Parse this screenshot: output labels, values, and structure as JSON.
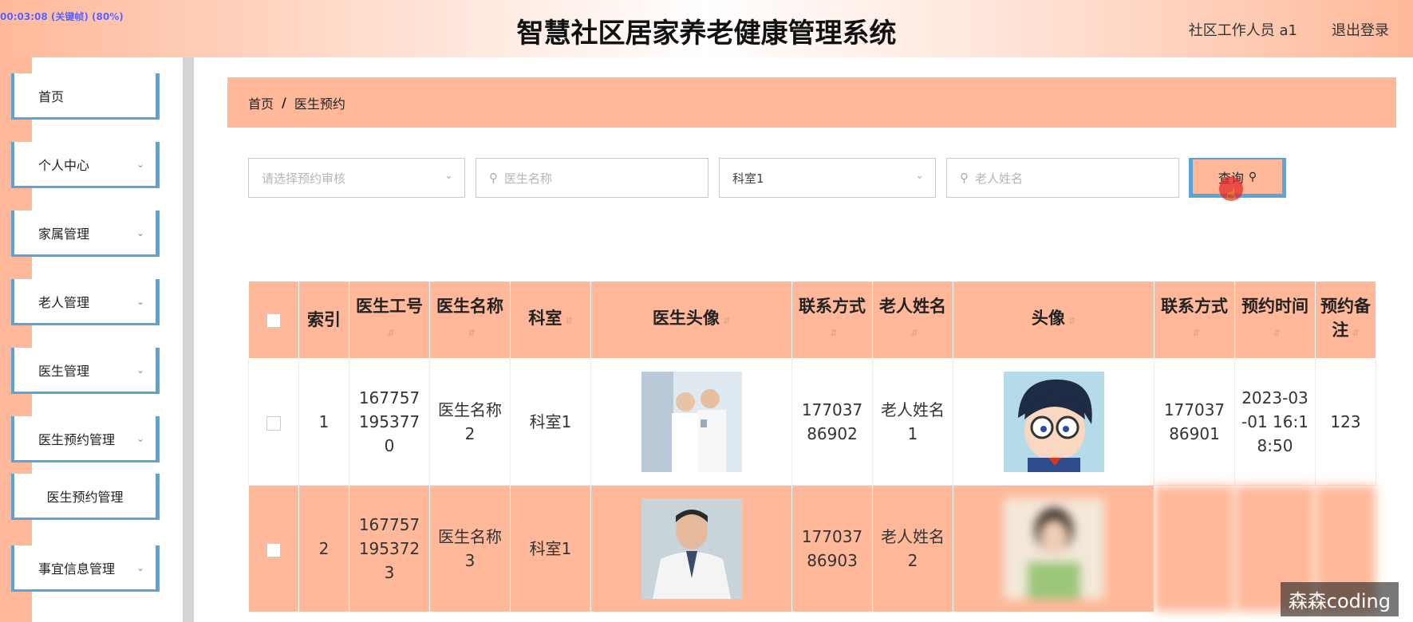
{
  "recording": "00:03:08 (关键帧) (80%)",
  "header": {
    "title": "智慧社区居家养老健康管理系统",
    "user": "社区工作人员 a1",
    "logout": "退出登录"
  },
  "sidebar": {
    "items": [
      {
        "label": "首页"
      },
      {
        "label": "个人中心"
      },
      {
        "label": "家属管理"
      },
      {
        "label": "老人管理"
      },
      {
        "label": "医生管理"
      },
      {
        "label": "医生预约管理"
      },
      {
        "label": "医生预约管理"
      },
      {
        "label": "事宜信息管理"
      }
    ]
  },
  "breadcrumb": {
    "home": "首页",
    "sep": "/",
    "current": "医生预约"
  },
  "search": {
    "audit_placeholder": "请选择预约审核",
    "doctor_placeholder": "医生名称",
    "dept_value": "科室1",
    "elder_placeholder": "老人姓名",
    "query_label": "查询"
  },
  "table": {
    "headers": [
      "索引",
      "医生工号",
      "医生名称",
      "科室",
      "医生头像",
      "联系方式",
      "老人姓名",
      "头像",
      "联系方式",
      "预约时间",
      "预约备注"
    ],
    "rows": [
      {
        "index": "1",
        "doctor_id": "1677571953770",
        "doctor_name": "医生名称2",
        "dept": "科室1",
        "doc_phone": "17703786902",
        "elder_name": "老人姓名1",
        "elder_phone": "17703786901",
        "time": "2023-03-01 16:18:50",
        "note": "123"
      },
      {
        "index": "2",
        "doctor_id": "1677571953723",
        "doctor_name": "医生名称3",
        "dept": "科室1",
        "doc_phone": "17703786903",
        "elder_name": "老人姓名2",
        "elder_phone": "",
        "time": "",
        "note": ""
      }
    ]
  },
  "watermark": "森森coding",
  "colors": {
    "accent": "#ffb99a",
    "border_blue": "#5aa5d6"
  }
}
